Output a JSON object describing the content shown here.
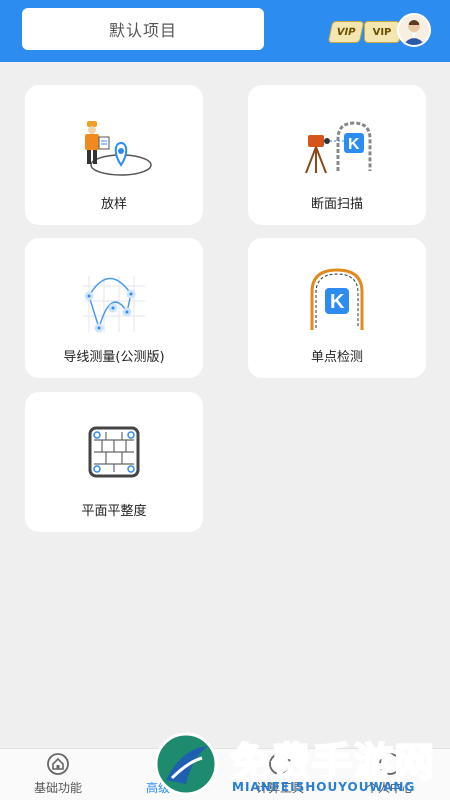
{
  "header": {
    "project_name": "默认项目",
    "vip_badge_1": "VIP",
    "vip_badge_2": "VIP"
  },
  "cards": [
    {
      "label": "放样",
      "icon": "surveyor-stakeout-icon"
    },
    {
      "label": "断面扫描",
      "icon": "tunnel-section-scan-icon"
    },
    {
      "label": "导线测量(公测版)",
      "icon": "traverse-network-icon"
    },
    {
      "label": "单点检测",
      "icon": "tunnel-point-check-icon"
    },
    {
      "label": "平面平整度",
      "icon": "wall-flatness-icon"
    }
  ],
  "tabs": [
    {
      "label": "基础功能",
      "icon": "home-icon",
      "active": false
    },
    {
      "label": "高级功能",
      "icon": "advanced-icon",
      "active": true
    },
    {
      "label": "计算工具",
      "icon": "calculator-icon",
      "active": false
    },
    {
      "label": "个人中心",
      "icon": "user-icon",
      "active": false
    }
  ],
  "watermark": {
    "title": "免费手游网",
    "subtitle": "MIANFEISHOUYOUWANG"
  },
  "colors": {
    "accent": "#2d8cf0",
    "background": "#efefef"
  }
}
